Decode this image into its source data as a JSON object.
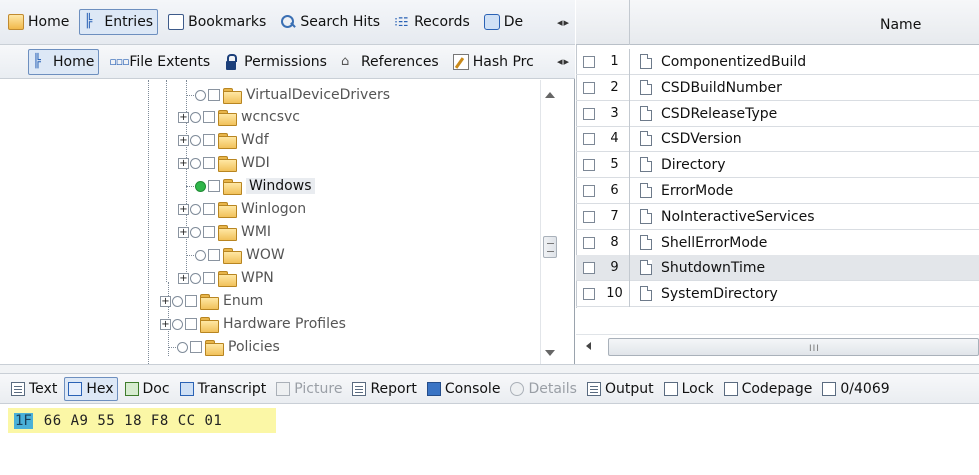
{
  "top_tabs": [
    {
      "label": "Home",
      "icon": "home-icon",
      "active": false
    },
    {
      "label": "Entries",
      "icon": "entries-tree-icon",
      "active": true
    },
    {
      "label": "Bookmarks",
      "icon": "bookmarks-icon",
      "active": false
    },
    {
      "label": "Search Hits",
      "icon": "search-icon",
      "active": false
    },
    {
      "label": "Records",
      "icon": "records-icon",
      "active": false
    },
    {
      "label": "De",
      "icon": "device-icon",
      "active": false
    }
  ],
  "sub_tabs": [
    {
      "label": "Home",
      "icon": "home-tree-icon",
      "active": true
    },
    {
      "label": "File Extents",
      "icon": "file-extents-icon",
      "active": false
    },
    {
      "label": "Permissions",
      "icon": "lock-icon",
      "active": false
    },
    {
      "label": "References",
      "icon": "references-icon",
      "active": false
    },
    {
      "label": "Hash Prc",
      "icon": "hash-icon",
      "active": false
    }
  ],
  "tree": [
    {
      "label": "VirtualDeviceDrivers",
      "expandable": false,
      "selected": false
    },
    {
      "label": "wcncsvc",
      "expandable": true,
      "selected": false
    },
    {
      "label": "Wdf",
      "expandable": true,
      "selected": false
    },
    {
      "label": "WDI",
      "expandable": true,
      "selected": false
    },
    {
      "label": "Windows",
      "expandable": false,
      "selected": true
    },
    {
      "label": "Winlogon",
      "expandable": true,
      "selected": false
    },
    {
      "label": "WMI",
      "expandable": true,
      "selected": false
    },
    {
      "label": "WOW",
      "expandable": false,
      "selected": false
    },
    {
      "label": "WPN",
      "expandable": true,
      "selected": false
    },
    {
      "label": "Enum",
      "expandable": true,
      "selected": false
    },
    {
      "label": "Hardware Profiles",
      "expandable": true,
      "selected": false
    },
    {
      "label": "Policies",
      "expandable": false,
      "selected": false
    }
  ],
  "grid": {
    "column_name": "Name",
    "rows": [
      {
        "num": "1",
        "name": "ComponentizedBuild"
      },
      {
        "num": "2",
        "name": "CSDBuildNumber"
      },
      {
        "num": "3",
        "name": "CSDReleaseType"
      },
      {
        "num": "4",
        "name": "CSDVersion"
      },
      {
        "num": "5",
        "name": "Directory"
      },
      {
        "num": "6",
        "name": "ErrorMode"
      },
      {
        "num": "7",
        "name": "NoInteractiveServices"
      },
      {
        "num": "8",
        "name": "ShellErrorMode"
      },
      {
        "num": "9",
        "name": "ShutdownTime",
        "selected": true
      },
      {
        "num": "10",
        "name": "SystemDirectory"
      }
    ],
    "hscroll_grip": "III"
  },
  "bottom_tabs": {
    "text": "Text",
    "hex": "Hex",
    "doc": "Doc",
    "transcript": "Transcript",
    "picture": "Picture",
    "report": "Report",
    "console": "Console",
    "details": "Details",
    "output": "Output",
    "lock": "Lock",
    "codepage": "Codepage",
    "offset": "0/4069"
  },
  "hex": {
    "first_byte": "1F",
    "rest_bytes": " 66 A9 55 18 F8 CC 01"
  },
  "colors": {
    "hex_highlight": "#fbf7a6",
    "cursor_byte": "#4ab0d8",
    "active_tab": "#dde8f6",
    "selected_node_dot": "#2fb64a"
  }
}
